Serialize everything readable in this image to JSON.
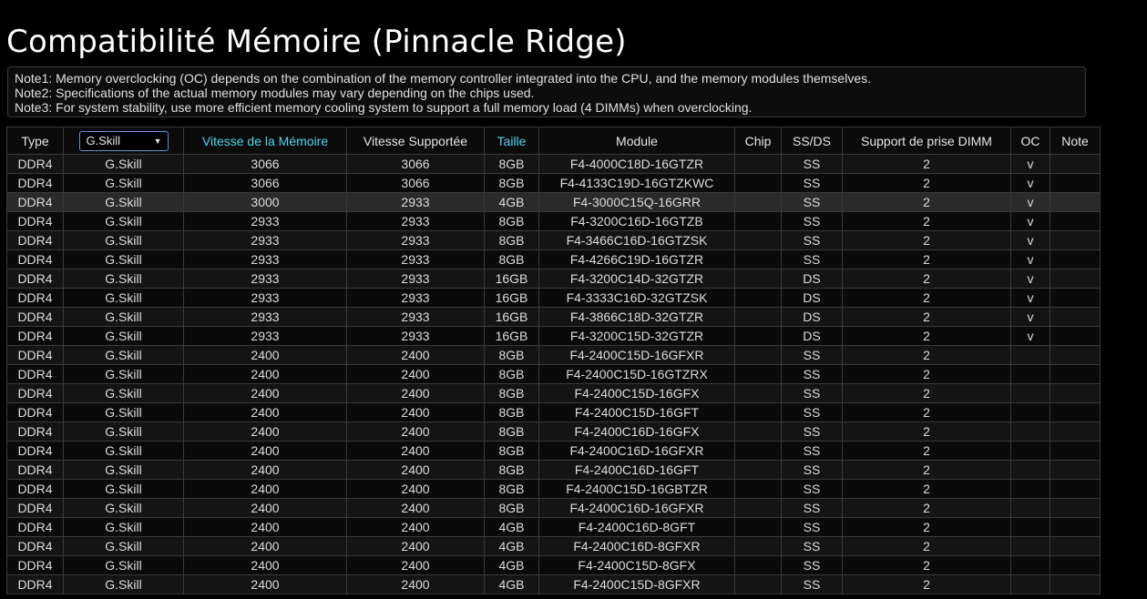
{
  "page": {
    "title": "Compatibilité Mémoire (Pinnacle Ridge)"
  },
  "notes": [
    "Note1: Memory overclocking (OC) depends on the combination of the memory controller integrated into the CPU, and the memory modules themselves.",
    "Note2: Specifications of the actual memory modules may vary depending on the chips used.",
    "Note3: For system stability, use more efficient memory cooling system to support a full memory load (4 DIMMs) when overclocking."
  ],
  "table": {
    "headers": {
      "type": "Type",
      "brand_selected": "G.Skill",
      "speed": "Vitesse de la Mémoire",
      "supported": "Vitesse Supportée",
      "size": "Taille",
      "module": "Module",
      "chip": "Chip",
      "ssds": "SS/DS",
      "dimm": "Support de prise DIMM",
      "oc": "OC",
      "note": "Note"
    },
    "colors": {
      "sortable_header": "#4fd6e8",
      "select_border": "#6c8fd6"
    },
    "rows": [
      {
        "type": "DDR4",
        "brand": "G.Skill",
        "speed": "3066",
        "supported": "3066",
        "size": "8GB",
        "module": "F4-4000C18D-16GTZR",
        "chip": "",
        "ssds": "SS",
        "dimm": "2",
        "oc": "v",
        "note": ""
      },
      {
        "type": "DDR4",
        "brand": "G.Skill",
        "speed": "3066",
        "supported": "3066",
        "size": "8GB",
        "module": "F4-4133C19D-16GTZKWC",
        "chip": "",
        "ssds": "SS",
        "dimm": "2",
        "oc": "v",
        "note": ""
      },
      {
        "type": "DDR4",
        "brand": "G.Skill",
        "speed": "3000",
        "supported": "2933",
        "size": "4GB",
        "module": "F4-3000C15Q-16GRR",
        "chip": "",
        "ssds": "SS",
        "dimm": "2",
        "oc": "v",
        "note": ""
      },
      {
        "type": "DDR4",
        "brand": "G.Skill",
        "speed": "2933",
        "supported": "2933",
        "size": "8GB",
        "module": "F4-3200C16D-16GTZB",
        "chip": "",
        "ssds": "SS",
        "dimm": "2",
        "oc": "v",
        "note": ""
      },
      {
        "type": "DDR4",
        "brand": "G.Skill",
        "speed": "2933",
        "supported": "2933",
        "size": "8GB",
        "module": "F4-3466C16D-16GTZSK",
        "chip": "",
        "ssds": "SS",
        "dimm": "2",
        "oc": "v",
        "note": ""
      },
      {
        "type": "DDR4",
        "brand": "G.Skill",
        "speed": "2933",
        "supported": "2933",
        "size": "8GB",
        "module": "F4-4266C19D-16GTZR",
        "chip": "",
        "ssds": "SS",
        "dimm": "2",
        "oc": "v",
        "note": ""
      },
      {
        "type": "DDR4",
        "brand": "G.Skill",
        "speed": "2933",
        "supported": "2933",
        "size": "16GB",
        "module": "F4-3200C14D-32GTZR",
        "chip": "",
        "ssds": "DS",
        "dimm": "2",
        "oc": "v",
        "note": ""
      },
      {
        "type": "DDR4",
        "brand": "G.Skill",
        "speed": "2933",
        "supported": "2933",
        "size": "16GB",
        "module": "F4-3333C16D-32GTZSK",
        "chip": "",
        "ssds": "DS",
        "dimm": "2",
        "oc": "v",
        "note": ""
      },
      {
        "type": "DDR4",
        "brand": "G.Skill",
        "speed": "2933",
        "supported": "2933",
        "size": "16GB",
        "module": "F4-3866C18D-32GTZR",
        "chip": "",
        "ssds": "DS",
        "dimm": "2",
        "oc": "v",
        "note": ""
      },
      {
        "type": "DDR4",
        "brand": "G.Skill",
        "speed": "2933",
        "supported": "2933",
        "size": "16GB",
        "module": "F4-3200C15D-32GTZR",
        "chip": "",
        "ssds": "DS",
        "dimm": "2",
        "oc": "v",
        "note": ""
      },
      {
        "type": "DDR4",
        "brand": "G.Skill",
        "speed": "2400",
        "supported": "2400",
        "size": "8GB",
        "module": "F4-2400C15D-16GFXR",
        "chip": "",
        "ssds": "SS",
        "dimm": "2",
        "oc": "",
        "note": ""
      },
      {
        "type": "DDR4",
        "brand": "G.Skill",
        "speed": "2400",
        "supported": "2400",
        "size": "8GB",
        "module": "F4-2400C15D-16GTZRX",
        "chip": "",
        "ssds": "SS",
        "dimm": "2",
        "oc": "",
        "note": ""
      },
      {
        "type": "DDR4",
        "brand": "G.Skill",
        "speed": "2400",
        "supported": "2400",
        "size": "8GB",
        "module": "F4-2400C15D-16GFX",
        "chip": "",
        "ssds": "SS",
        "dimm": "2",
        "oc": "",
        "note": ""
      },
      {
        "type": "DDR4",
        "brand": "G.Skill",
        "speed": "2400",
        "supported": "2400",
        "size": "8GB",
        "module": "F4-2400C15D-16GFT",
        "chip": "",
        "ssds": "SS",
        "dimm": "2",
        "oc": "",
        "note": ""
      },
      {
        "type": "DDR4",
        "brand": "G.Skill",
        "speed": "2400",
        "supported": "2400",
        "size": "8GB",
        "module": "F4-2400C16D-16GFX",
        "chip": "",
        "ssds": "SS",
        "dimm": "2",
        "oc": "",
        "note": ""
      },
      {
        "type": "DDR4",
        "brand": "G.Skill",
        "speed": "2400",
        "supported": "2400",
        "size": "8GB",
        "module": "F4-2400C16D-16GFXR",
        "chip": "",
        "ssds": "SS",
        "dimm": "2",
        "oc": "",
        "note": ""
      },
      {
        "type": "DDR4",
        "brand": "G.Skill",
        "speed": "2400",
        "supported": "2400",
        "size": "8GB",
        "module": "F4-2400C16D-16GFT",
        "chip": "",
        "ssds": "SS",
        "dimm": "2",
        "oc": "",
        "note": ""
      },
      {
        "type": "DDR4",
        "brand": "G.Skill",
        "speed": "2400",
        "supported": "2400",
        "size": "8GB",
        "module": "F4-2400C15D-16GBTZR",
        "chip": "",
        "ssds": "SS",
        "dimm": "2",
        "oc": "",
        "note": ""
      },
      {
        "type": "DDR4",
        "brand": "G.Skill",
        "speed": "2400",
        "supported": "2400",
        "size": "8GB",
        "module": "F4-2400C16D-16GFXR",
        "chip": "",
        "ssds": "SS",
        "dimm": "2",
        "oc": "",
        "note": ""
      },
      {
        "type": "DDR4",
        "brand": "G.Skill",
        "speed": "2400",
        "supported": "2400",
        "size": "4GB",
        "module": "F4-2400C16D-8GFT",
        "chip": "",
        "ssds": "SS",
        "dimm": "2",
        "oc": "",
        "note": ""
      },
      {
        "type": "DDR4",
        "brand": "G.Skill",
        "speed": "2400",
        "supported": "2400",
        "size": "4GB",
        "module": "F4-2400C16D-8GFXR",
        "chip": "",
        "ssds": "SS",
        "dimm": "2",
        "oc": "",
        "note": ""
      },
      {
        "type": "DDR4",
        "brand": "G.Skill",
        "speed": "2400",
        "supported": "2400",
        "size": "4GB",
        "module": "F4-2400C15D-8GFX",
        "chip": "",
        "ssds": "SS",
        "dimm": "2",
        "oc": "",
        "note": ""
      },
      {
        "type": "DDR4",
        "brand": "G.Skill",
        "speed": "2400",
        "supported": "2400",
        "size": "4GB",
        "module": "F4-2400C15D-8GFXR",
        "chip": "",
        "ssds": "SS",
        "dimm": "2",
        "oc": "",
        "note": ""
      }
    ]
  }
}
